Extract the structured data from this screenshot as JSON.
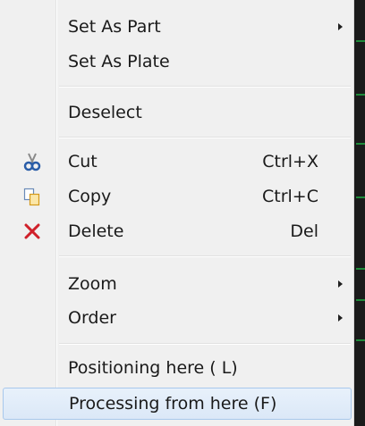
{
  "menu": {
    "items": [
      {
        "label": "Set As Part",
        "shortcut": "",
        "submenu": true
      },
      {
        "label": "Set As Plate",
        "shortcut": "",
        "submenu": false
      },
      {
        "label": "Deselect",
        "shortcut": "",
        "submenu": false
      },
      {
        "label": "Cut",
        "shortcut": "Ctrl+X",
        "icon": "scissors-icon"
      },
      {
        "label": "Copy",
        "shortcut": "Ctrl+C",
        "icon": "copy-icon"
      },
      {
        "label": "Delete",
        "shortcut": "Del",
        "icon": "delete-x-icon"
      },
      {
        "label": "Zoom",
        "shortcut": "",
        "submenu": true
      },
      {
        "label": "Order",
        "shortcut": "",
        "submenu": true
      },
      {
        "label": "Positioning here ( L)",
        "shortcut": ""
      },
      {
        "label": "Processing from here (F)",
        "shortcut": "",
        "highlighted": true
      }
    ]
  },
  "colors": {
    "menu_background": "#f0f0f0",
    "highlight": "#dbe8f7",
    "highlight_border": "#a8c8ec",
    "delete_icon": "#d0202a",
    "scissors_icon": "#2a5da8",
    "copy_icon": "#e8b53a"
  }
}
